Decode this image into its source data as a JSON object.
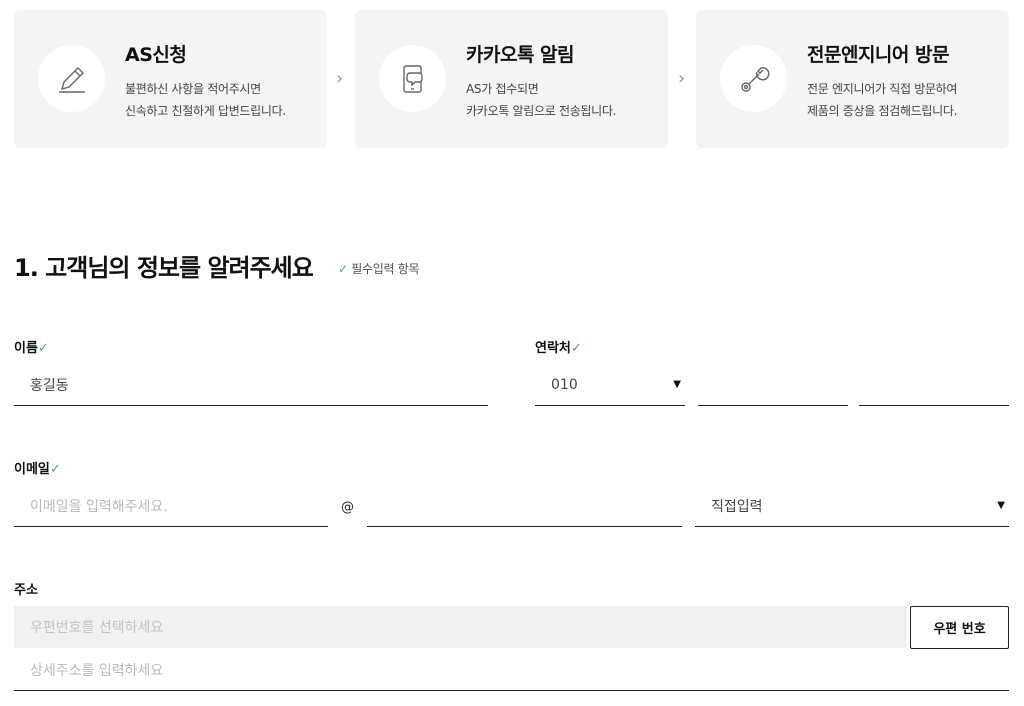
{
  "steps": [
    {
      "title": "AS신청",
      "desc1": "불편하신 사항을 적어주시면",
      "desc2": "신속하고 친절하게 답변드립니다.",
      "icon": "pencil-icon"
    },
    {
      "title": "카카오톡 알림",
      "desc1": "AS가 접수되면",
      "desc2": "카카오톡 알림으로 전송됩니다.",
      "icon": "phone-chat-icon"
    },
    {
      "title": "전문엔지니어 방문",
      "desc1": "전문 엔지니어가 직접 방문하여",
      "desc2": "제품의 증상을 점검해드립니다.",
      "icon": "wrench-icon"
    }
  ],
  "arrow_glyph": "›",
  "section": {
    "title": "1. 고객님의 정보를 알려주세요",
    "required_note": "필수입력 항목",
    "check": "✓"
  },
  "form": {
    "name_label": "이름",
    "name_value": "홍길동",
    "phone_label": "연락처",
    "phone_prefix": "010",
    "email_label": "이메일",
    "email_placeholder": "이메일을 입력해주세요.",
    "at_symbol": "@",
    "email_domain_select": "직접입력",
    "address_label": "주소",
    "zip_placeholder": "우편번호를 선택하세요",
    "zip_button": "우편 번호",
    "detail_placeholder": "상세주소를 입력하세요"
  },
  "colors": {
    "accent_check": "#3a9ad9",
    "card_bg": "#f4f4f4"
  }
}
